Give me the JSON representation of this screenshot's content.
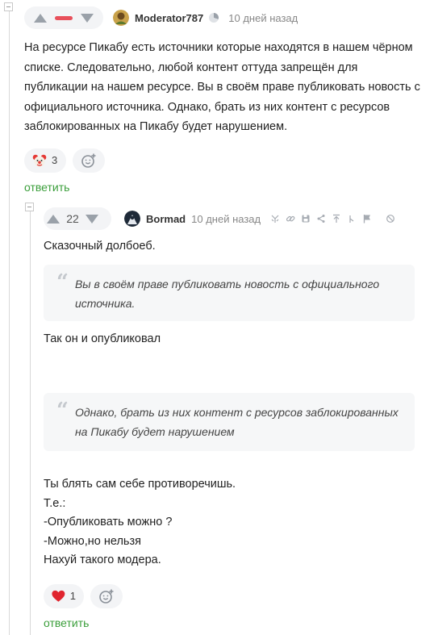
{
  "comment1": {
    "author": "Moderator787",
    "date": "10 дней назад",
    "text": "На ресурсе Пикабу есть источники которые находятся в нашем чёрном списке. Следовательно, любой контент оттуда запрещён для публикации на нашем ресурсе. Вы в своём праве публиковать новость с официального источника. Однако, брать из них контент с ресурсов заблокированных на Пикабу будет нарушением.",
    "reaction_icon": "clown-face-icon",
    "reaction_count": "3",
    "reply_label": "ответить"
  },
  "comment2": {
    "rating": "22",
    "author": "Bormad",
    "date": "10 дней назад",
    "line1": "Сказочный долбоеб.",
    "quote1": "Вы в своём праве публиковать новость с официального источника.",
    "line2": "Так он и опубликовал",
    "quote2": "Однако, брать из них контент с ресурсов заблокированных на Пикабу будет нарушением",
    "tail_lines": [
      "Ты блять сам себе противоречишь.",
      "Т.е.:",
      "-Опубликовать можно ?",
      "-Можно,но нельзя",
      "Нахуй такого модера."
    ],
    "reaction_icon": "heart-icon",
    "reaction_count": "1",
    "reply_label": "ответить",
    "tools": [
      "branch-icon",
      "link-icon",
      "save-icon",
      "share-icon",
      "pin-top-icon",
      "pin-icon",
      "flag-icon",
      "block-icon"
    ]
  },
  "colors": {
    "minus": "#e8505b",
    "link": "#3a9e3a",
    "heart": "#e0252f",
    "arrow": "#9aa1a9"
  }
}
